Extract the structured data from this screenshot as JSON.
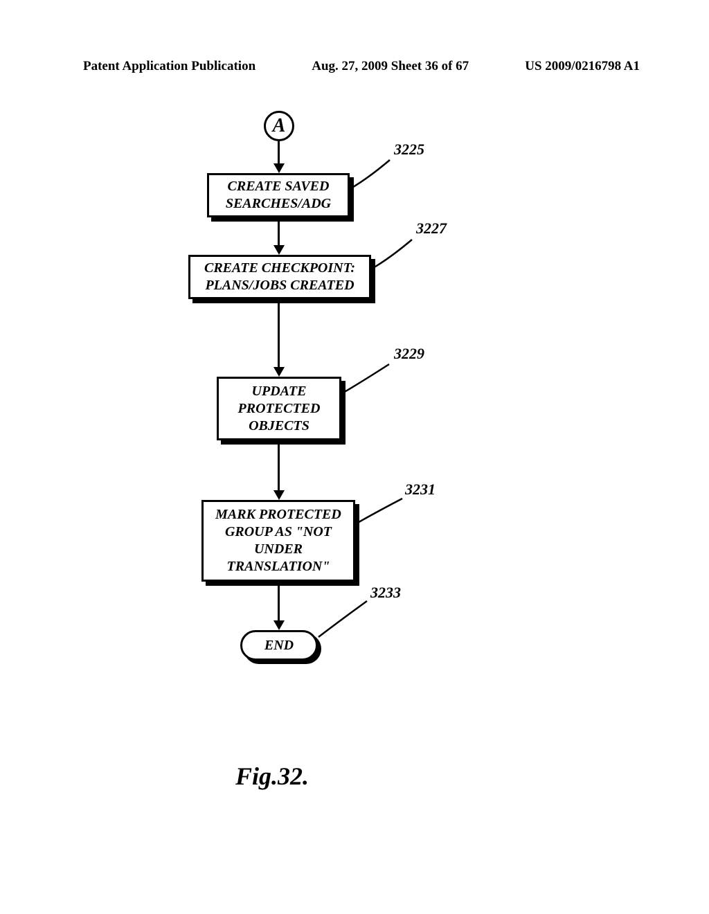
{
  "header": {
    "pub_type": "Patent Application Publication",
    "date_sheet": "Aug. 27, 2009  Sheet 36 of 67",
    "pub_number": "US 2009/0216798 A1"
  },
  "flowchart": {
    "connector": "A",
    "steps": [
      {
        "text": "CREATE SAVED SEARCHES/ADG",
        "ref": "3225"
      },
      {
        "text": "CREATE CHECKPOINT: PLANS/JOBS CREATED",
        "ref": "3227"
      },
      {
        "text": "UPDATE PROTECTED OBJECTS",
        "ref": "3229"
      },
      {
        "text": "MARK PROTECTED GROUP AS \"NOT UNDER TRANSLATION\"",
        "ref": "3231"
      }
    ],
    "terminator": {
      "text": "END",
      "ref": "3233"
    }
  },
  "figure_caption": "Fig.32."
}
